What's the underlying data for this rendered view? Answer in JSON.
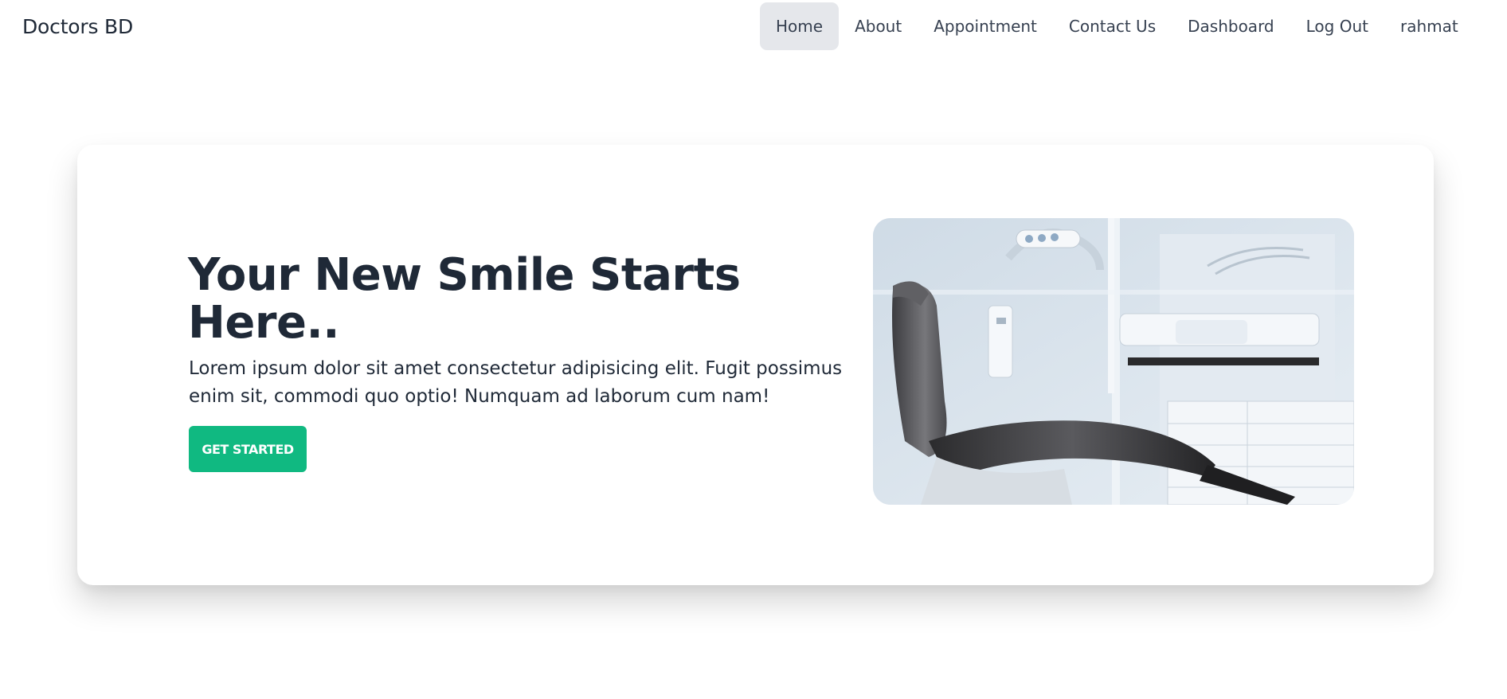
{
  "brand": "Doctors BD",
  "nav": {
    "items": [
      {
        "label": "Home",
        "active": true
      },
      {
        "label": "About",
        "active": false
      },
      {
        "label": "Appointment",
        "active": false
      },
      {
        "label": "Contact Us",
        "active": false
      },
      {
        "label": "Dashboard",
        "active": false
      },
      {
        "label": "Log Out",
        "active": false
      },
      {
        "label": "rahmat",
        "active": false
      }
    ]
  },
  "hero": {
    "title": "Your New Smile Starts Here..",
    "text": "Lorem ipsum dolor sit amet consectetur adipisicing elit. Fugit possimus enim sit, commodi quo optio! Numquam ad laborum cum nam!",
    "cta_label": "GET STARTED",
    "image_icon": "dental-chair-photo"
  },
  "colors": {
    "accent": "#10b981",
    "active_nav_bg": "#e5e7eb",
    "text_dark": "#1f2937"
  }
}
